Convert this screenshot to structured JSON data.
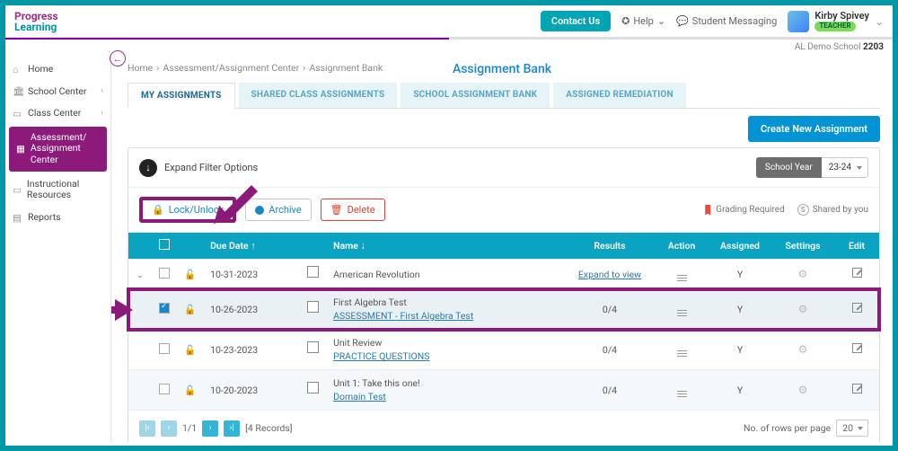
{
  "brand": {
    "line1": "Progress",
    "line2": "Learning"
  },
  "header": {
    "contact": "Contact Us",
    "help": "Help",
    "messaging": "Student Messaging",
    "user_name": "Kirby Spivey",
    "user_role": "TEACHER",
    "school_context": "AL Demo School",
    "school_code": "2203"
  },
  "sidebar": {
    "items": [
      {
        "label": "Home"
      },
      {
        "label": "School Center",
        "expandable": true
      },
      {
        "label": "Class Center",
        "expandable": true
      },
      {
        "label": "Assessment/ Assignment Center",
        "active": true
      },
      {
        "label": "Instructional Resources"
      },
      {
        "label": "Reports"
      }
    ]
  },
  "breadcrumb": {
    "a": "Home",
    "b": "Assessment/Assignment Center",
    "c": "Assignment Bank"
  },
  "page_title": "Assignment Bank",
  "tabs": [
    {
      "label": "MY ASSIGNMENTS",
      "active": true
    },
    {
      "label": "SHARED CLASS ASSIGNMENTS"
    },
    {
      "label": "SCHOOL ASSIGNMENT BANK"
    },
    {
      "label": "ASSIGNED REMEDIATION"
    }
  ],
  "buttons": {
    "create": "Create New Assignment",
    "expand_filter": "Expand Filter Options",
    "lock": "Lock/Unlock",
    "archive": "Archive",
    "delete": "Delete"
  },
  "school_year": {
    "label": "School Year",
    "value": "23-24"
  },
  "legend": {
    "grading": "Grading Required",
    "shared": "Shared by you"
  },
  "columns": {
    "due": "Due Date",
    "name": "Name",
    "results": "Results",
    "action": "Action",
    "assigned": "Assigned",
    "settings": "Settings",
    "edit": "Edit"
  },
  "rows": [
    {
      "checked": false,
      "caret": true,
      "due": "10-31-2023",
      "title": "American Revolution",
      "sub": "",
      "results": "Expand to view",
      "results_link": true,
      "assigned": "Y"
    },
    {
      "checked": true,
      "caret": false,
      "due": "10-26-2023",
      "title": "First Algebra Test",
      "sub": "ASSESSMENT - First Algebra Test",
      "results": "0/4",
      "assigned": "Y",
      "highlight": true
    },
    {
      "checked": false,
      "caret": false,
      "due": "10-23-2023",
      "title": "Unit Review",
      "sub": "PRACTICE QUESTIONS",
      "results": "0/4",
      "assigned": "Y"
    },
    {
      "checked": false,
      "caret": false,
      "due": "10-20-2023",
      "title": "Unit 1: Take this one!",
      "sub": "Domain Test",
      "results": "0/4",
      "assigned": "Y"
    }
  ],
  "pager": {
    "page": "1/1",
    "records": "[4 Records]",
    "rows_label": "No. of rows per page",
    "rows_value": "20"
  }
}
